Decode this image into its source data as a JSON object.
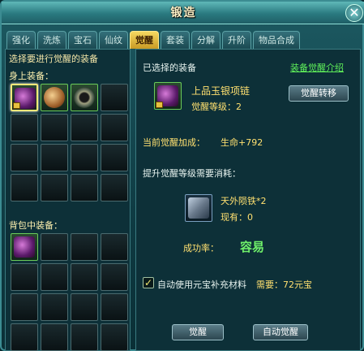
{
  "window": {
    "title": "锻造",
    "close_label": "✕"
  },
  "tabs": [
    {
      "label": "强化"
    },
    {
      "label": "洗炼"
    },
    {
      "label": "宝石"
    },
    {
      "label": "仙纹"
    },
    {
      "label": "觉醒"
    },
    {
      "label": "套装"
    },
    {
      "label": "分解"
    },
    {
      "label": "升阶"
    },
    {
      "label": "物品合成"
    }
  ],
  "left": {
    "heading": "选择要进行觉醒的装备",
    "body_label": "身上装备：",
    "bag_label": "背包中装备：",
    "body_items": [
      "necklace-icon",
      "orb-icon",
      "ring-icon"
    ],
    "bag_items": [
      "necklace-icon"
    ]
  },
  "right": {
    "selected_label": "已选择的装备",
    "intro_link": "装备觉醒介绍",
    "item_name": "上品玉银项链",
    "awaken_level": "觉醒等级：2",
    "transfer_button": "觉醒转移",
    "bonus_label": "当前觉醒加成：",
    "bonus_value": "生命+792",
    "cost_label": "提升觉醒等级需要消耗：",
    "material_name": "天外陨铁*2",
    "material_owned": "现有：0",
    "success_label": "成功率：",
    "success_value": "容易",
    "auto_label": "自动使用元宝补充材料",
    "need_label": "需要：72元宝",
    "awaken_button": "觉醒",
    "auto_awaken_button": "自动觉醒"
  },
  "colors": {
    "accent_gold": "#ffe070",
    "accent_green": "#6ff06a",
    "tab_active": "#f4d860"
  }
}
